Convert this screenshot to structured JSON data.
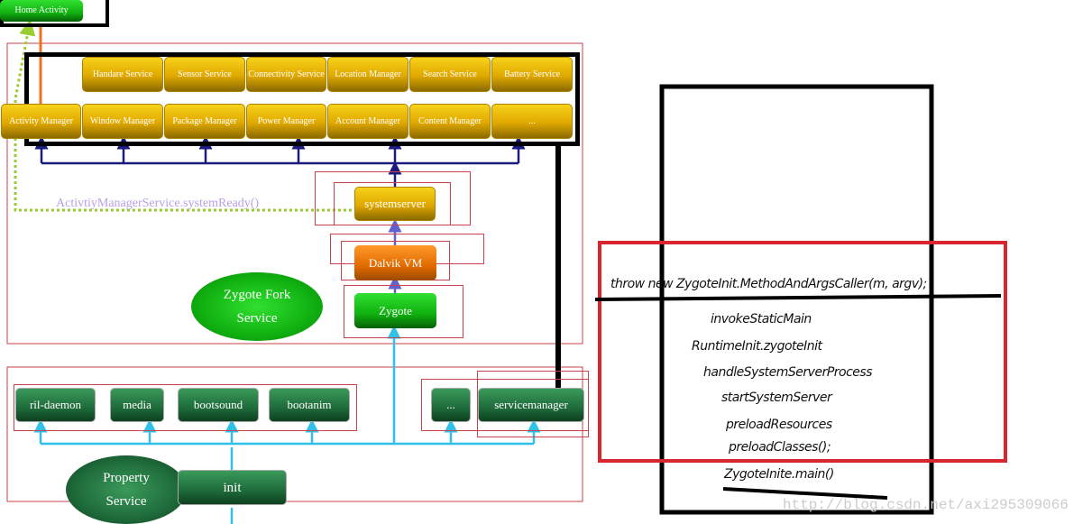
{
  "home_activity": "Home Activity",
  "top_row": [
    "Handare Service",
    "Sensor Service",
    "Connectivity Service",
    "Location Manager",
    "Search Service",
    "Battery Service"
  ],
  "second_row": [
    "Activity Manager",
    "Window Manager",
    "Package Manager",
    "Power Manager",
    "Account Manager",
    "Content Manager",
    "..."
  ],
  "system_ready": "ActivtiyManagerService.systemReady()",
  "systemserver": "systemserver",
  "dalvik": "Dalvik VM",
  "zygote": "Zygote",
  "zygote_fork": "Zygote Fork Service",
  "daemons": [
    "ril-daemon",
    "media",
    "bootsound",
    "bootanim"
  ],
  "ellipsis": "...",
  "servicemanager": "servicemanager",
  "property_service": "Property Service",
  "init": "init",
  "calls": [
    "throw new ZygoteInit.MethodAndArgsCaller(m, argv);",
    "invokeStaticMain",
    "RuntimeInit.zygoteInit",
    "handleSystemServerProcess",
    "startSystemServer",
    "preloadResources",
    "preloadClasses();",
    "ZygoteInite.main()"
  ],
  "watermark": "http://blog.csdn.net/axi295309066",
  "colors": {
    "red": "#c8414b",
    "annotation_red": "#d9262e",
    "blue": "#1a1a80",
    "cyan": "#30c0e8",
    "green_dotted": "#9acd32",
    "orange": "#f07020",
    "purple_text": "#b8a0e8"
  }
}
